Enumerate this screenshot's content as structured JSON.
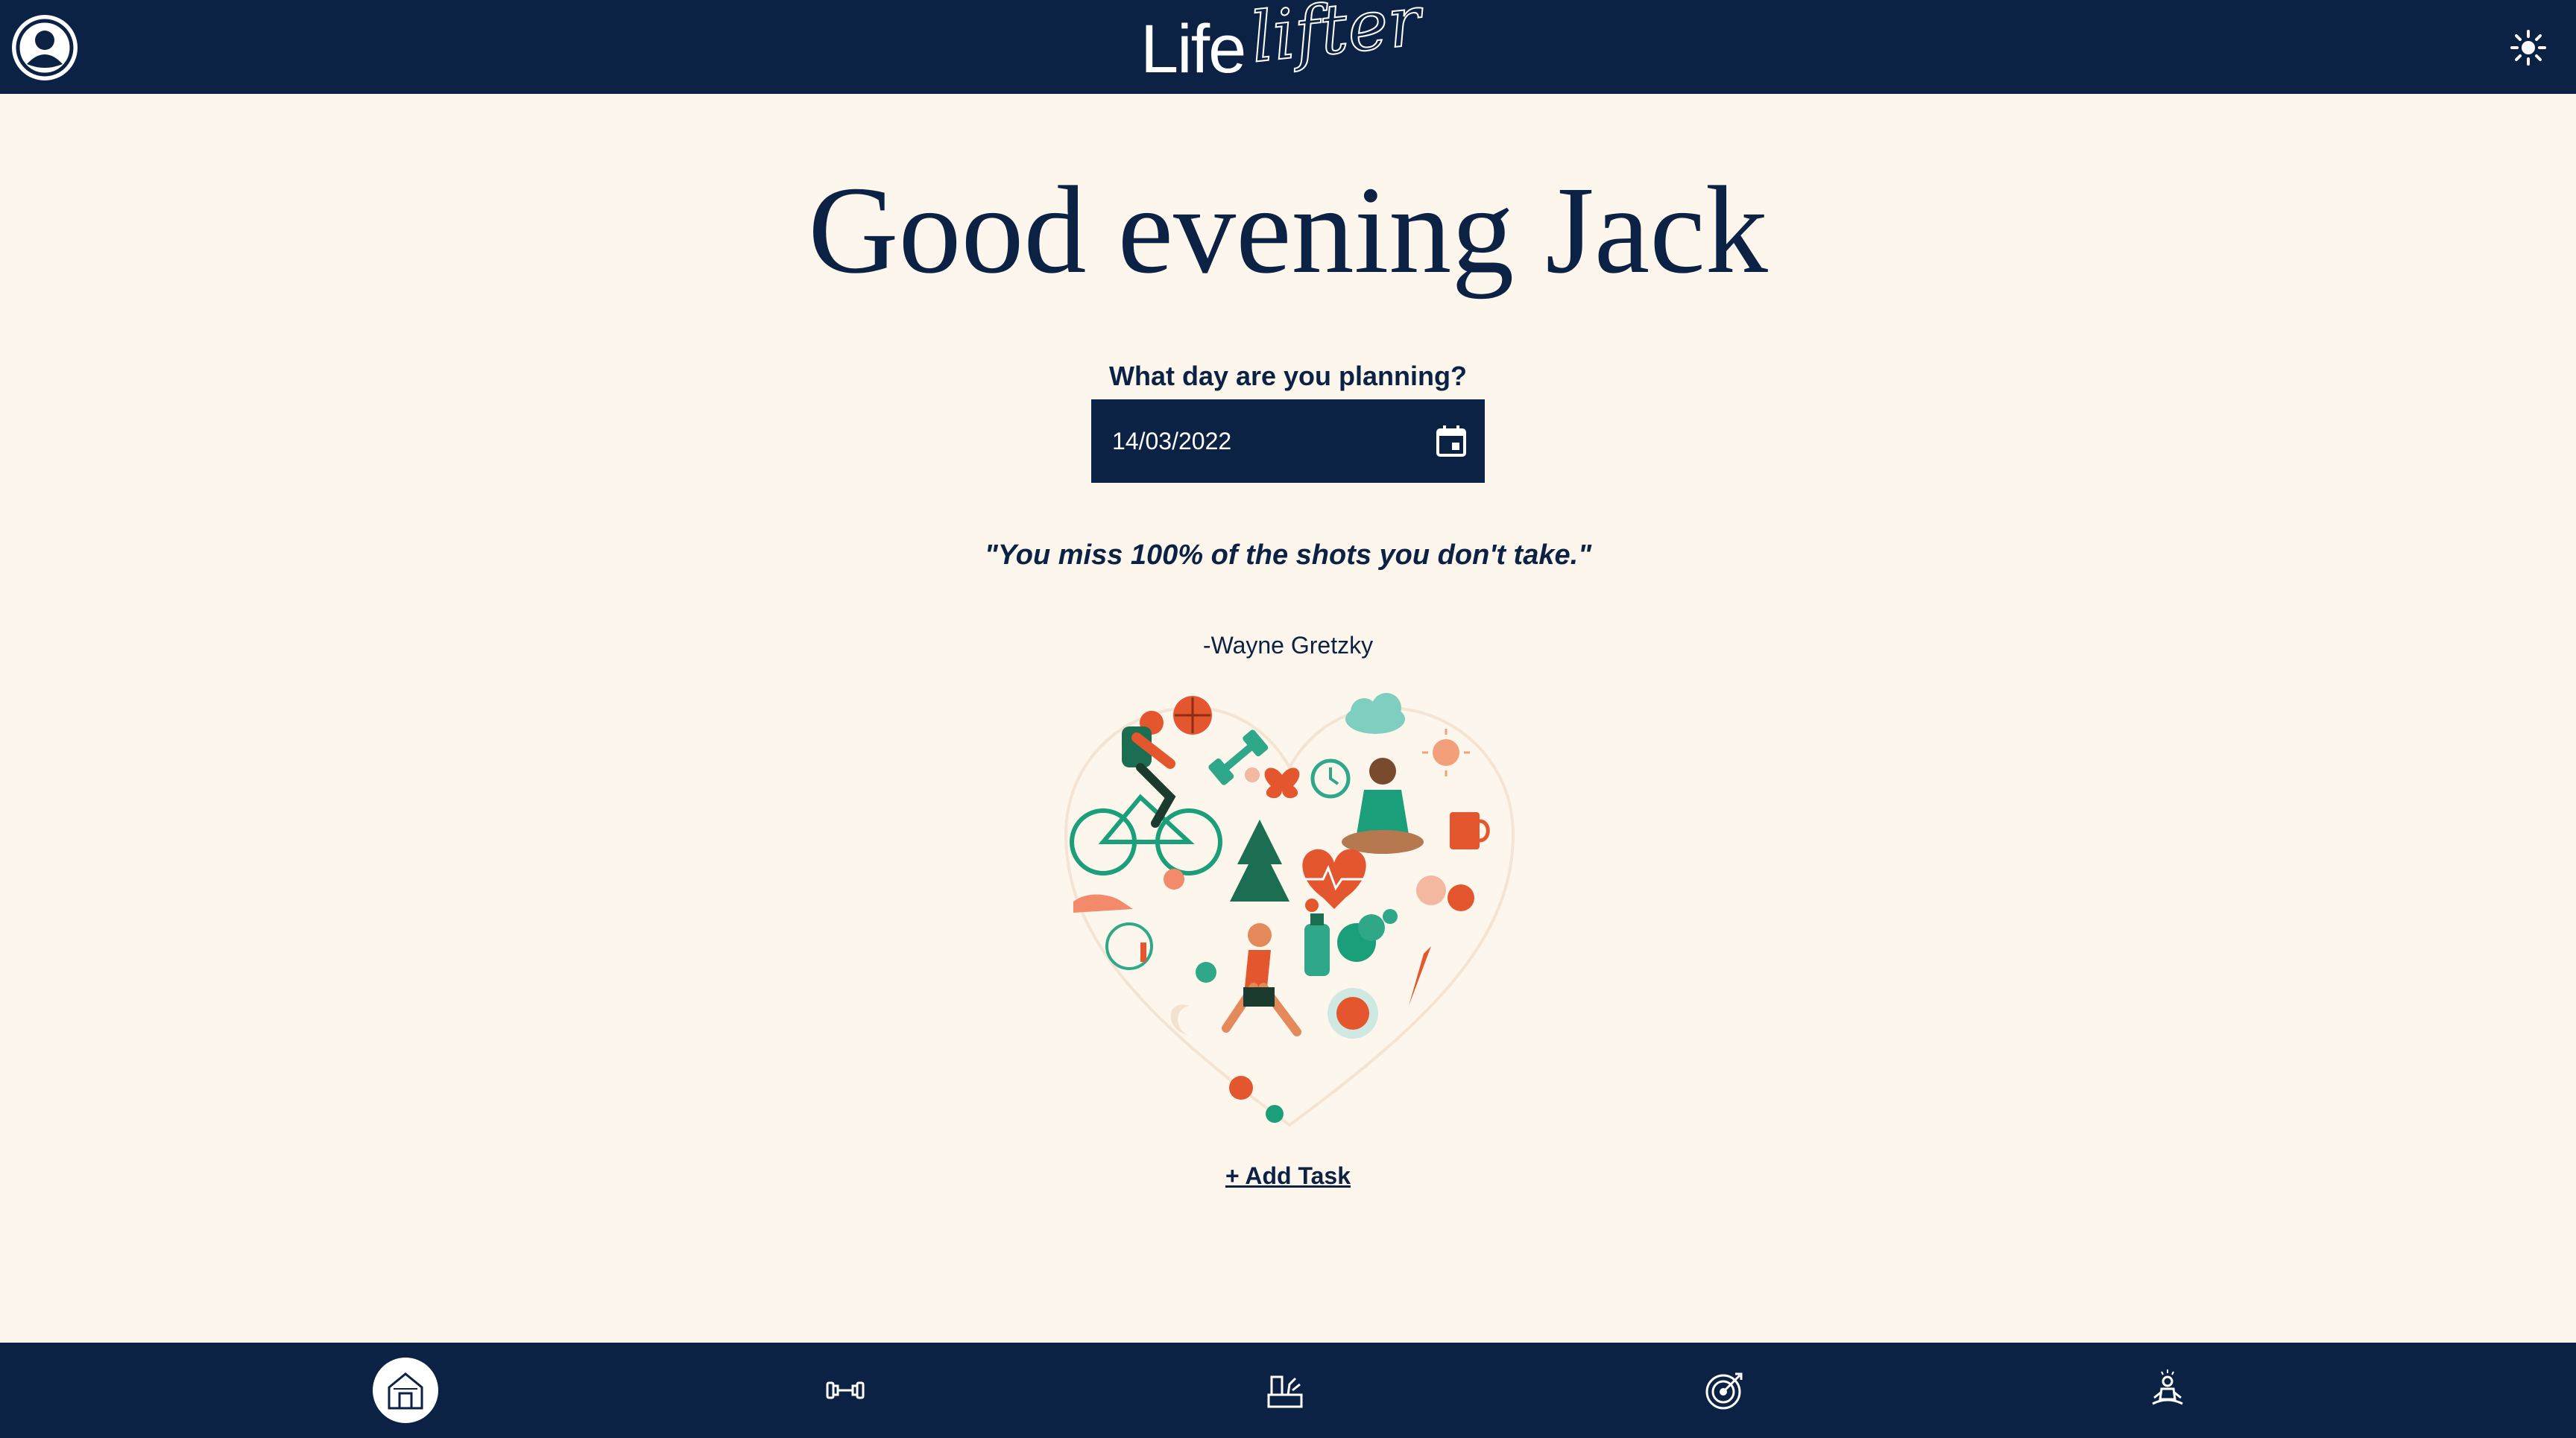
{
  "header": {
    "logo_life": "Life",
    "logo_lifter": "lifter",
    "profile_icon": "user-icon",
    "theme_icon": "sun-icon"
  },
  "main": {
    "greeting": "Good evening Jack",
    "date_prompt": "What day are you planning?",
    "date_value": "14/03/2022",
    "quote": "\"You miss 100% of the shots you don't take.\"",
    "quote_author": "-Wayne Gretzky",
    "add_task_label": "+ Add Task"
  },
  "bottom_nav": {
    "items": [
      {
        "icon": "home-icon",
        "active": true
      },
      {
        "icon": "dumbbell-icon",
        "active": false
      },
      {
        "icon": "nutrition-icon",
        "active": false
      },
      {
        "icon": "target-icon",
        "active": false
      },
      {
        "icon": "meditation-icon",
        "active": false
      }
    ]
  },
  "colors": {
    "navy": "#0c2244",
    "cream": "#fdf6ec",
    "accent_red": "#e4572e",
    "accent_teal": "#1b9e7a"
  }
}
